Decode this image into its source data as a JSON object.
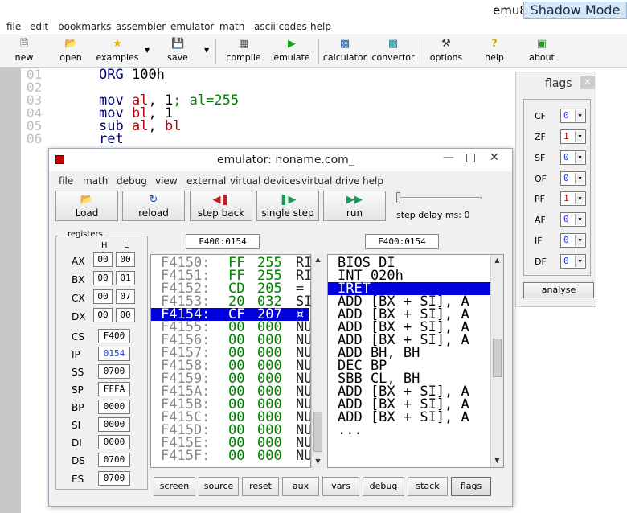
{
  "window": {
    "title": "emu8",
    "shadow_mode": "Shadow Mode"
  },
  "menu": [
    "file",
    "edit",
    "bookmarks",
    "assembler",
    "emulator",
    "math",
    "ascii codes",
    "help"
  ],
  "toolbar": {
    "new": "new",
    "open": "open",
    "examples": "examples",
    "save": "save",
    "compile": "compile",
    "emulate": "emulate",
    "calculator": "calculator",
    "convertor": "convertor",
    "options": "options",
    "help": "help",
    "about": "about"
  },
  "editor": {
    "line_numbers": [
      "01",
      "02",
      "03",
      "04",
      "05",
      "06"
    ],
    "lines": [
      {
        "kw": "ORG",
        "arg": "100h"
      },
      {
        "kw": "",
        "arg": ""
      },
      {
        "kw": "mov",
        "reg": "al",
        "sep": ", ",
        "num": "1",
        "comment": "; al=255"
      },
      {
        "kw": "mov",
        "reg": "bl",
        "sep": ", ",
        "num": "1",
        "comment": ""
      },
      {
        "kw": "sub",
        "reg": "al",
        "sep": ", ",
        "reg2": "bl",
        "comment": ""
      },
      {
        "kw": "ret",
        "reg": "",
        "sep": "",
        "comment": ""
      }
    ]
  },
  "emulator": {
    "title": "emulator: noname.com_",
    "menu": [
      "file",
      "math",
      "debug",
      "view",
      "external",
      "virtual devices",
      "virtual drive",
      "help"
    ],
    "buttons": {
      "load": "Load",
      "reload": "reload",
      "step_back": "step back",
      "single_step": "single step",
      "run": "run"
    },
    "step_delay_label": "step delay ms: 0",
    "registers_label": "registers",
    "h_label": "H",
    "l_label": "L",
    "regs8": [
      {
        "name": "AX",
        "h": "00",
        "l": "00"
      },
      {
        "name": "BX",
        "h": "00",
        "l": "01"
      },
      {
        "name": "CX",
        "h": "00",
        "l": "07"
      },
      {
        "name": "DX",
        "h": "00",
        "l": "00"
      }
    ],
    "regs16": [
      {
        "name": "CS",
        "v": "F400"
      },
      {
        "name": "IP",
        "v": "0154"
      },
      {
        "name": "SS",
        "v": "0700"
      },
      {
        "name": "SP",
        "v": "FFFA"
      },
      {
        "name": "BP",
        "v": "0000"
      },
      {
        "name": "SI",
        "v": "0000"
      },
      {
        "name": "DI",
        "v": "0000"
      },
      {
        "name": "DS",
        "v": "0700"
      },
      {
        "name": "ES",
        "v": "0700"
      }
    ],
    "mem_addr": "F400:0154",
    "dis_addr": "F400:0154",
    "memory": [
      {
        "a": "F4150:",
        "h": "FF",
        "d": "255",
        "c": "RI"
      },
      {
        "a": "F4151:",
        "h": "FF",
        "d": "255",
        "c": "RI"
      },
      {
        "a": "F4152:",
        "h": "CD",
        "d": "205",
        "c": "="
      },
      {
        "a": "F4153:",
        "h": "20",
        "d": "032",
        "c": "SI"
      },
      {
        "a": "F4154:",
        "h": "CF",
        "d": "207",
        "c": "¤"
      },
      {
        "a": "F4155:",
        "h": "00",
        "d": "000",
        "c": "NU"
      },
      {
        "a": "F4156:",
        "h": "00",
        "d": "000",
        "c": "NU"
      },
      {
        "a": "F4157:",
        "h": "00",
        "d": "000",
        "c": "NU"
      },
      {
        "a": "F4158:",
        "h": "00",
        "d": "000",
        "c": "NU"
      },
      {
        "a": "F4159:",
        "h": "00",
        "d": "000",
        "c": "NU"
      },
      {
        "a": "F415A:",
        "h": "00",
        "d": "000",
        "c": "NU"
      },
      {
        "a": "F415B:",
        "h": "00",
        "d": "000",
        "c": "NU"
      },
      {
        "a": "F415C:",
        "h": "00",
        "d": "000",
        "c": "NU"
      },
      {
        "a": "F415D:",
        "h": "00",
        "d": "000",
        "c": "NU"
      },
      {
        "a": "F415E:",
        "h": "00",
        "d": "000",
        "c": "NU"
      },
      {
        "a": "F415F:",
        "h": "00",
        "d": "000",
        "c": "NU"
      }
    ],
    "disasm": [
      "BIOS DI",
      "INT 020h",
      "IRET",
      "ADD [BX + SI], A",
      "ADD [BX + SI], A",
      "ADD [BX + SI], A",
      "ADD [BX + SI], A",
      "ADD BH, BH",
      "DEC BP",
      "SBB CL, BH",
      "ADD [BX + SI], A",
      "ADD [BX + SI], A",
      "ADD [BX + SI], A",
      "..."
    ],
    "bottom": [
      "screen",
      "source",
      "reset",
      "aux",
      "vars",
      "debug",
      "stack",
      "flags"
    ]
  },
  "flags": {
    "title": "flags",
    "items": [
      {
        "name": "CF",
        "v": "0"
      },
      {
        "name": "ZF",
        "v": "1"
      },
      {
        "name": "SF",
        "v": "0"
      },
      {
        "name": "OF",
        "v": "0"
      },
      {
        "name": "PF",
        "v": "1"
      },
      {
        "name": "AF",
        "v": "0"
      },
      {
        "name": "IF",
        "v": "0"
      },
      {
        "name": "DF",
        "v": "0"
      }
    ],
    "analyse": "analyse"
  }
}
